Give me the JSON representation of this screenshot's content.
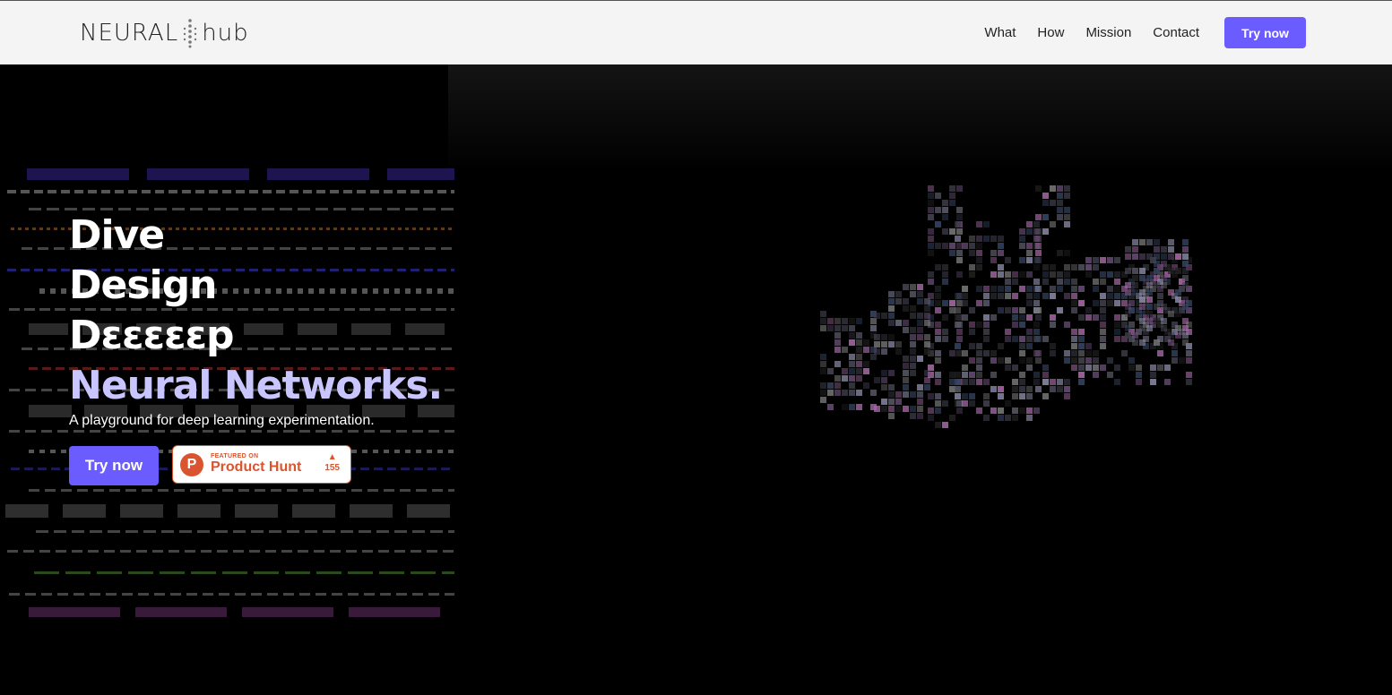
{
  "header": {
    "logo_left": "NEURAL",
    "logo_right": "hub",
    "nav": [
      {
        "label": "What"
      },
      {
        "label": "How"
      },
      {
        "label": "Mission"
      },
      {
        "label": "Contact"
      }
    ],
    "cta_label": "Try now"
  },
  "hero": {
    "lines": [
      "Dive",
      "Design",
      "Dεεεεεp"
    ],
    "accent_line": "Neural Networks.",
    "subtitle": "A playground for deep learning experimentation.",
    "cta_label": "Try now",
    "product_hunt": {
      "featured": "FEATURED ON",
      "name": "Product Hunt",
      "logo_letter": "P",
      "arrow": "▲",
      "votes": "155"
    }
  },
  "colors": {
    "accent": "#6b5cff",
    "accent_light": "#c9c6ff",
    "product_hunt": "#da552f",
    "navbar_bg": "#f4f4f4",
    "hero_bg": "#000000"
  },
  "icons": {
    "logo_mark": "neural-dots-icon",
    "product_hunt": "product-hunt-logo-icon",
    "upvote": "upvote-arrow-icon"
  }
}
